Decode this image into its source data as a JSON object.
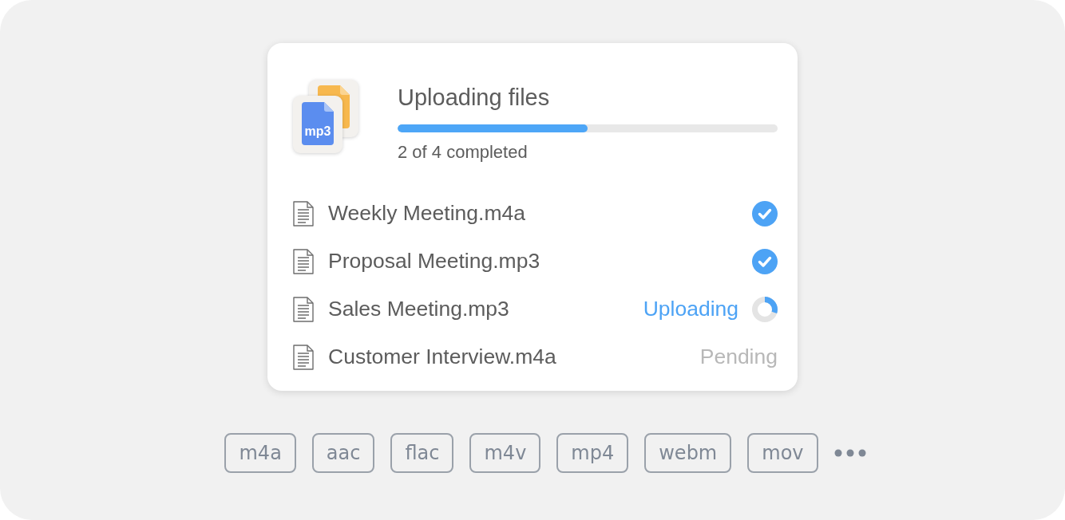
{
  "header": {
    "icon_label": "mp3",
    "title": "Uploading files",
    "progress": {
      "level": 0.5
    },
    "summary": "2 of 4 completed"
  },
  "files": [
    {
      "name": "Weekly Meeting.m4a",
      "kind": "done"
    },
    {
      "name": "Proposal Meeting.mp3",
      "kind": "done"
    },
    {
      "name": "Sales Meeting.mp3",
      "kind": "uploading",
      "status": "Uploading",
      "level": 0.3
    },
    {
      "name": "Customer Interview.m4a",
      "kind": "pending",
      "status": "Pending"
    }
  ],
  "formats": [
    "m4a",
    "aac",
    "flac",
    "m4v",
    "mp4",
    "webm",
    "mov"
  ]
}
